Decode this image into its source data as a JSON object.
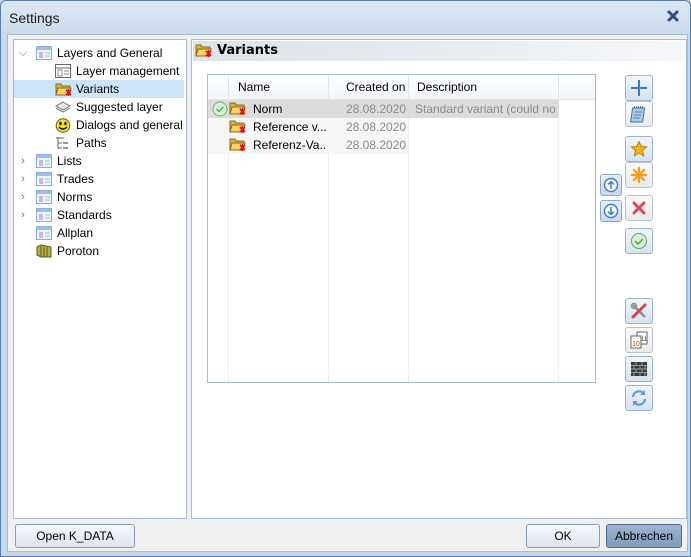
{
  "window": {
    "title": "Settings",
    "close_icon": "close-icon"
  },
  "tree": {
    "items": [
      {
        "label": "Layers and General",
        "icon": "layer-list-icon",
        "expanded": true
      },
      {
        "label": "Layer management",
        "icon": "layer-management-icon"
      },
      {
        "label": "Variants",
        "icon": "variant-folder-icon",
        "selected": true
      },
      {
        "label": "Suggested layer",
        "icon": "suggested-layer-icon"
      },
      {
        "label": "Dialogs and general",
        "icon": "smiley-icon"
      },
      {
        "label": "Paths",
        "icon": "paths-icon"
      },
      {
        "label": "Lists",
        "icon": "layer-list-icon",
        "expandable": true
      },
      {
        "label": "Trades",
        "icon": "layer-list-icon",
        "expandable": true
      },
      {
        "label": "Norms",
        "icon": "layer-list-icon",
        "expandable": true
      },
      {
        "label": "Standards",
        "icon": "layer-list-icon",
        "expandable": true
      },
      {
        "label": "Allplan",
        "icon": "layer-list-icon"
      },
      {
        "label": "Poroton",
        "icon": "poroton-icon"
      }
    ]
  },
  "panel": {
    "title": "Variants"
  },
  "grid": {
    "columns": [
      "Name",
      "Created on",
      "Description"
    ],
    "rows": [
      {
        "name": "Norm",
        "created": "28.08.2020",
        "description": "Standard variant (could no...",
        "active": true
      },
      {
        "name": "Reference v...",
        "created": "28.08.2020",
        "description": ""
      },
      {
        "name": "Referenz-Va...",
        "created": "28.08.2020",
        "description": ""
      }
    ]
  },
  "toolbar": {
    "add": "add-icon",
    "edit": "notepad-icon",
    "favorite": "star-icon",
    "new": "asterisk-icon",
    "delete": "delete-icon",
    "activate": "check-icon",
    "tools": "tools-icon",
    "numbering": "numbering-icon",
    "wall": "wall-icon",
    "refresh": "refresh-icon",
    "move_up": "arrow-up-icon",
    "move_down": "arrow-down-icon"
  },
  "footer": {
    "open_kdata": "Open K_DATA",
    "ok": "OK",
    "cancel": "Abbrechen"
  }
}
